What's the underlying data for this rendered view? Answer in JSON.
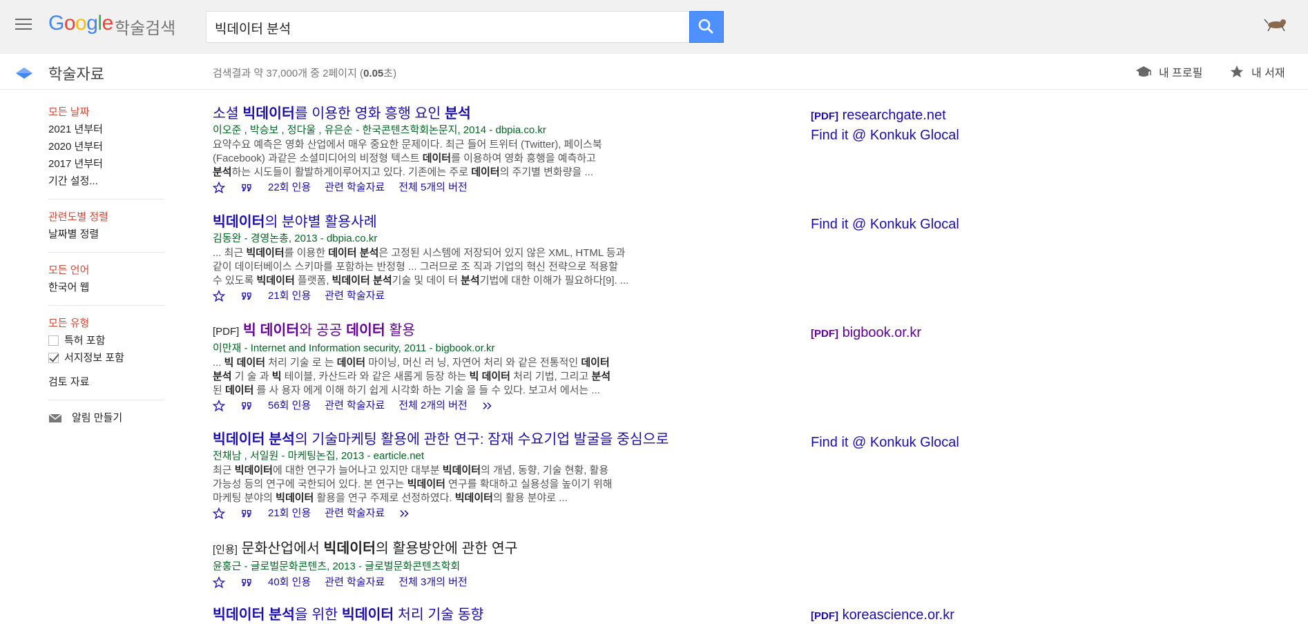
{
  "header": {
    "logo": "Google",
    "logo_sub": "학술검색",
    "search_value": "빅데이터 분석"
  },
  "subbar": {
    "title": "학술자료",
    "result_prefix": "검색결과 약 37,000개 중 2페이지 (",
    "result_time": "0.05",
    "result_suffix": "초)",
    "profile": "내 프로필",
    "library": "내 서재"
  },
  "sidebar": {
    "dates": [
      "모든 날짜",
      "2021 년부터",
      "2020 년부터",
      "2017 년부터",
      "기간 설정..."
    ],
    "sort": [
      "관련도별 정렬",
      "날짜별 정렬"
    ],
    "language": [
      "모든 언어",
      "한국어 웹"
    ],
    "type_all": "모든 유형",
    "include_patents": "특허 포함",
    "include_citations": "서지정보 포함",
    "review": "검토 자료",
    "alert": "알림 만들기"
  },
  "results": [
    {
      "tag": "",
      "title_parts": [
        "소셜 ",
        "빅데이터",
        "를 이용한 영화 흥행 요인 ",
        "분석"
      ],
      "meta": "이오준 ,  박승보 ,  정다울 ,  유은순 - 한국콘텐츠학회논문지, 2014 - dbpia.co.kr",
      "snippet": [
        [
          "요약수요 예측은 영화 산업에서 매우 중요한 문제이다. 최근 들어 트위터 (Twitter), 페이스북"
        ],
        [
          "(Facebook) 과같은 소셜미디어의 비정형 텍스트 ",
          "데이터",
          "를 이용하여 영화 흥행을 예측하고"
        ],
        [
          "분석",
          "하는 시도들이 활발하게이루어지고 있다. 기존에는 주로 ",
          "데이터",
          "의 주기별 변화량을 ..."
        ]
      ],
      "cited": "22회 인용",
      "related": "관련 학술자료",
      "versions": "전체 5개의 버전"
    },
    {
      "tag": "",
      "title_parts": [
        "빅데이터",
        "의 분야별 활용사례"
      ],
      "meta": "김동완 - 경영논총, 2013 - dbpia.co.kr",
      "snippet": [
        [
          "... 최근 ",
          "빅데이터",
          "를 이용한 ",
          "데이터 분석",
          "은 고정된 시스템에 저장되어 있지 않은 XML, HTML 등과"
        ],
        [
          "같이 데이터베이스 스키마를 포함하는 반정형 ... 그러므로 조 직과 기업의 혁신 전략으로 적용할"
        ],
        [
          "수 있도록 ",
          "빅데이터",
          " 플랫폼, ",
          "빅데이터 분석",
          "기술 및 데이 터 ",
          "분석",
          "기법에 대한 이해가 필요하다[9]. ..."
        ]
      ],
      "cited": "21회 인용",
      "related": "관련 학술자료",
      "versions": ""
    },
    {
      "tag": "[PDF]",
      "title_parts": [
        "빅 데이터",
        "와 공공 ",
        "데이터",
        " 활용"
      ],
      "meta": "이만재 - Internet and Information security, 2011 - bigbook.or.kr",
      "snippet": [
        [
          "... ",
          "빅 데이터",
          " 처리 기술 로 는 ",
          "데이터",
          " 마이닝, 머신 러 닝, 자연어 처리 와 같은 전통적인 ",
          "데이터"
        ],
        [
          "분석",
          " 기 술 과 ",
          "빅",
          " 테이블, 카산드라 와 같은 새롭게 등장 하는 ",
          "빅 데이터",
          " 처리 기법, 그리고 ",
          "분석"
        ],
        [
          "된 ",
          "데이터",
          " 를 사 용자 에게 이해 하기 쉽게 시각화 하는 기술 을 들 수 있다. 보고서 에서는 ..."
        ]
      ],
      "cited": "56회 인용",
      "related": "관련 학술자료",
      "versions": "전체 2개의 버전"
    },
    {
      "tag": "",
      "title_parts": [
        "빅데이터 분석",
        "의 기술마케팅 활용에 관한 연구: 잠재 수요기업 발굴을 중심으로"
      ],
      "meta": "전채남 ,  서일원 - 마케팅논집, 2013 - earticle.net",
      "snippet": [
        [
          "최근 ",
          "빅데이터",
          "에 대한 연구가 늘어나고 있지만 대부분 ",
          "빅데이터",
          "의 개념, 동향, 기술 현황, 활용"
        ],
        [
          "가능성 등의 연구에 국한되어 있다. 본 연구는 ",
          "빅데이터",
          " 연구를 확대하고 실용성을 높이기 위해"
        ],
        [
          "마케팅 분야의 ",
          "빅데이터",
          " 활용을 연구 주제로 선정하였다. ",
          "빅데이터",
          "의 활용 분야로 ..."
        ]
      ],
      "cited": "21회 인용",
      "related": "관련 학술자료",
      "versions": ""
    },
    {
      "tag": "[인용]",
      "title_parts": [
        "문화산업에서 ",
        "빅데이터",
        "의 활용방안에 관한 연구"
      ],
      "meta": "윤홍근 - 글로벌문화콘텐츠, 2013 - 글로벌문화콘텐츠학회",
      "snippet": [],
      "cited": "40회 인용",
      "related": "관련 학술자료",
      "versions": "전체 3개의 버전"
    },
    {
      "tag": "",
      "title_parts": [
        "빅데이터 분석",
        "을 위한 ",
        "빅데이터",
        " 처리 기술 동향"
      ],
      "meta": "",
      "snippet": [],
      "cited": "",
      "related": "",
      "versions": ""
    }
  ],
  "side_links": [
    {
      "pdf": "[PDF]",
      "text": "researchgate.net"
    },
    {
      "pdf": "",
      "text": "Find it @ Konkuk Glocal"
    },
    {
      "pdf": "",
      "text": "Find it @ Konkuk Glocal"
    },
    {
      "pdf": "[PDF]",
      "text": "bigbook.or.kr"
    },
    {
      "pdf": "",
      "text": "Find it @ Konkuk Glocal"
    },
    {
      "pdf": "[PDF]",
      "text": "koreascience.or.kr"
    }
  ],
  "colors": {
    "link": "#1a0dab",
    "visited": "#660099",
    "meta_green": "#006621",
    "active_red": "#d14836",
    "search_blue": "#4d90fe"
  }
}
